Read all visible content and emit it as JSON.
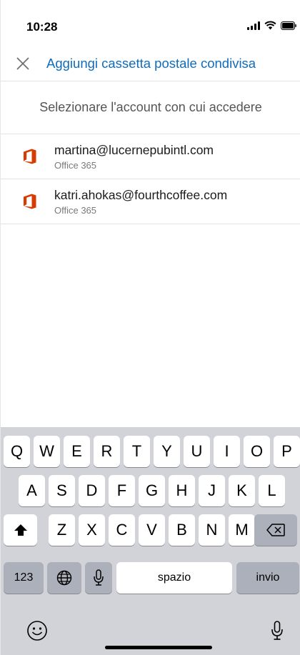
{
  "status_bar": {
    "time": "10:28"
  },
  "header": {
    "title": "Aggiungi cassetta postale condivisa"
  },
  "subtitle": "Selezionare l'account con cui accedere",
  "accounts": [
    {
      "email": "martina@lucernepubintl.com",
      "type": "Office 365"
    },
    {
      "email": "katri.ahokas@fourthcoffee.com",
      "type": "Office 365"
    }
  ],
  "keyboard": {
    "row1": [
      "Q",
      "W",
      "E",
      "R",
      "T",
      "Y",
      "U",
      "I",
      "O",
      "P"
    ],
    "row2": [
      "A",
      "S",
      "D",
      "F",
      "G",
      "H",
      "J",
      "K",
      "L"
    ],
    "row3": [
      "Z",
      "X",
      "C",
      "V",
      "B",
      "N",
      "M"
    ],
    "numbers_label": "123",
    "space_label": "spazio",
    "return_label": "invio"
  },
  "colors": {
    "accent": "#0f6cbd",
    "office": "#d83b01",
    "keyboard_bg": "#d1d3d9"
  }
}
